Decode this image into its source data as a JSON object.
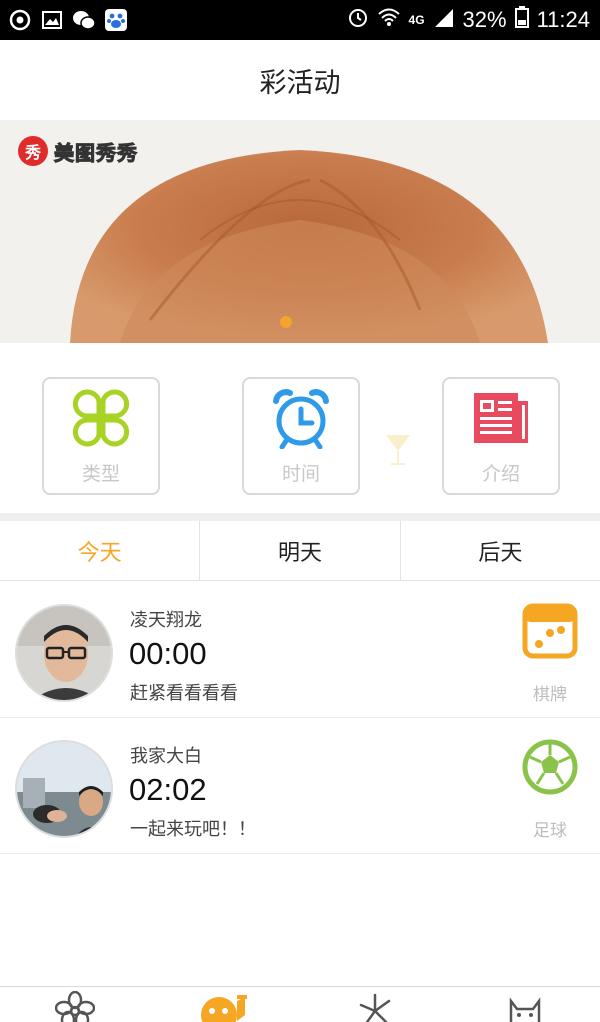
{
  "status_bar": {
    "network": "4G",
    "battery": "32%",
    "time": "11:24"
  },
  "header": {
    "title": "彩活动"
  },
  "banner": {
    "watermark": "美图秀秀",
    "watermark_badge": "秀",
    "page_count": 1,
    "active_page": 1
  },
  "categories": [
    {
      "label": "类型",
      "icon": "clover-icon",
      "color": "#a8d324"
    },
    {
      "label": "时间",
      "icon": "alarm-clock-icon",
      "color": "#2f9be8"
    },
    {
      "label": "介绍",
      "icon": "newspaper-icon",
      "color": "#e84b5f"
    }
  ],
  "tabs": [
    {
      "label": "今天",
      "active": true
    },
    {
      "label": "明天",
      "active": false
    },
    {
      "label": "后天",
      "active": false
    }
  ],
  "activities": [
    {
      "user": "凌天翔龙",
      "time": "00:00",
      "message": "赶紧看看看看",
      "category": "棋牌",
      "category_icon": "dice-icon"
    },
    {
      "user": "我家大白",
      "time": "02:02",
      "message": "一起来玩吧！！",
      "category": "足球",
      "category_icon": "soccer-ball-icon"
    }
  ],
  "bottom_nav": [
    {
      "icon": "flower-icon"
    },
    {
      "icon": "mascot-face-icon",
      "active": true
    },
    {
      "icon": "fireworks-icon"
    },
    {
      "icon": "cat-face-icon"
    }
  ],
  "colors": {
    "accent": "#f5a623",
    "clover": "#a8d324",
    "clock": "#2f9be8",
    "news": "#e84b5f",
    "dice": "#f5a623",
    "soccer": "#8bc34a"
  }
}
